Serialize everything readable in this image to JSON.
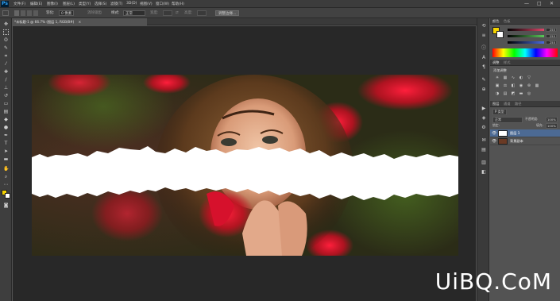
{
  "app": {
    "logo": "Ps"
  },
  "menubar": {
    "items": [
      "文件(F)",
      "编辑(E)",
      "图像(I)",
      "图层(L)",
      "类型(Y)",
      "选择(S)",
      "滤镜(T)",
      "3D(D)",
      "视图(V)",
      "窗口(W)",
      "帮助(H)"
    ],
    "win_min": "—",
    "win_max": "□",
    "win_close": "✕"
  },
  "options": {
    "feather_label": "羽化:",
    "feather_value": "0 像素",
    "antialias": "消除锯齿",
    "style_label": "样式:",
    "style_value": "正常",
    "width_label": "宽度:",
    "height_label": "高度:",
    "refine_button": "调整边缘..."
  },
  "document": {
    "tab_title": "*未标题-1 @ 66.7% (图层 1, RGB/8#)",
    "tab_close": "×"
  },
  "panels": {
    "color": {
      "tab1": "颜色",
      "tab2": "色板",
      "r": "255",
      "g": "255",
      "b": "255",
      "accent_r": "#e0456a",
      "accent_g": "#5ac85a",
      "accent_b": "#4a6ae0"
    },
    "adjust": {
      "tab1": "调整",
      "tab2": "样式",
      "title": "添加调整"
    },
    "layers": {
      "tab1": "图层",
      "tab2": "通道",
      "tab3": "路径",
      "kind": "P 类型",
      "blend": "正常",
      "opacity_label": "不透明度:",
      "opacity": "100%",
      "lock_label": "锁定:",
      "fill_label": "填充:",
      "fill": "100%",
      "rows": [
        {
          "name": "图层 1"
        },
        {
          "name": "背景副本"
        }
      ]
    }
  },
  "watermark": "UiBQ.CoM"
}
